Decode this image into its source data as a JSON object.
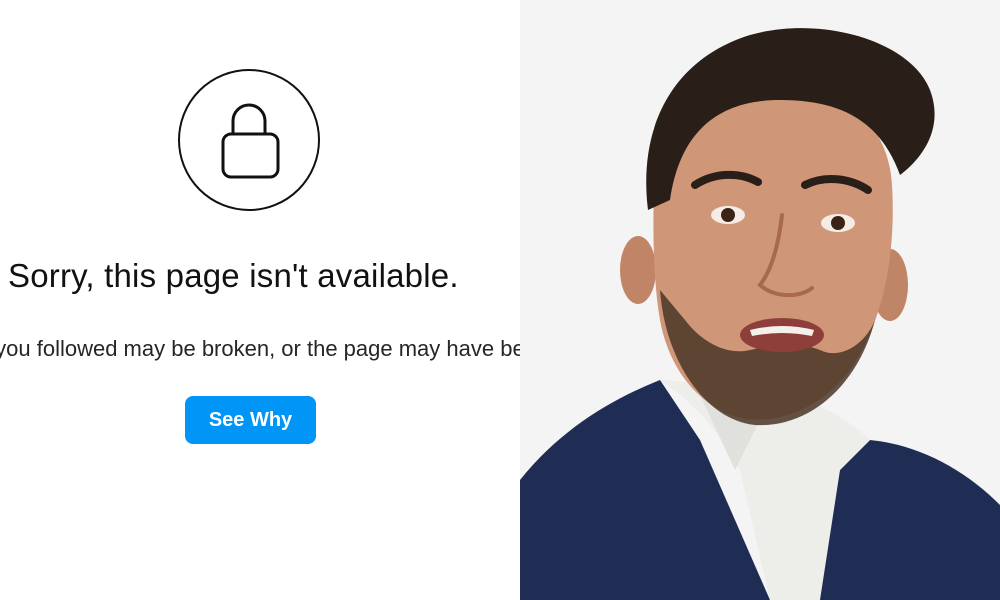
{
  "error_screen": {
    "icon": "lock-icon",
    "title": "Sorry, this page isn't available.",
    "subtitle": "The link you followed may be broken, or the page may have been removed.",
    "button_label": "See Why",
    "button_color": "#0095f6"
  },
  "photo": {
    "subject": "portrait-photo",
    "background_color": "#f4f4f5"
  }
}
